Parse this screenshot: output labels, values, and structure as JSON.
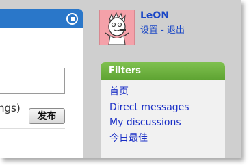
{
  "user": {
    "name": "LeON",
    "settings_label": "设置",
    "separator": "-",
    "logout_label": "退出"
  },
  "composer": {
    "hint_text": "ngs)",
    "publish_label": "发布"
  },
  "filters": {
    "title": "Filters",
    "items": [
      {
        "label": "首页"
      },
      {
        "label": "Direct messages"
      },
      {
        "label": "My discussions"
      },
      {
        "label": "今日最佳"
      }
    ]
  },
  "colors": {
    "header_blue": "#2a77c9",
    "filters_green": "#6ab13d",
    "link_blue": "#1a47c6",
    "background_gray": "#cfcfcf"
  },
  "icons": {
    "header_icon": "pause-circle-icon",
    "avatar": "cartoon-avatar"
  }
}
